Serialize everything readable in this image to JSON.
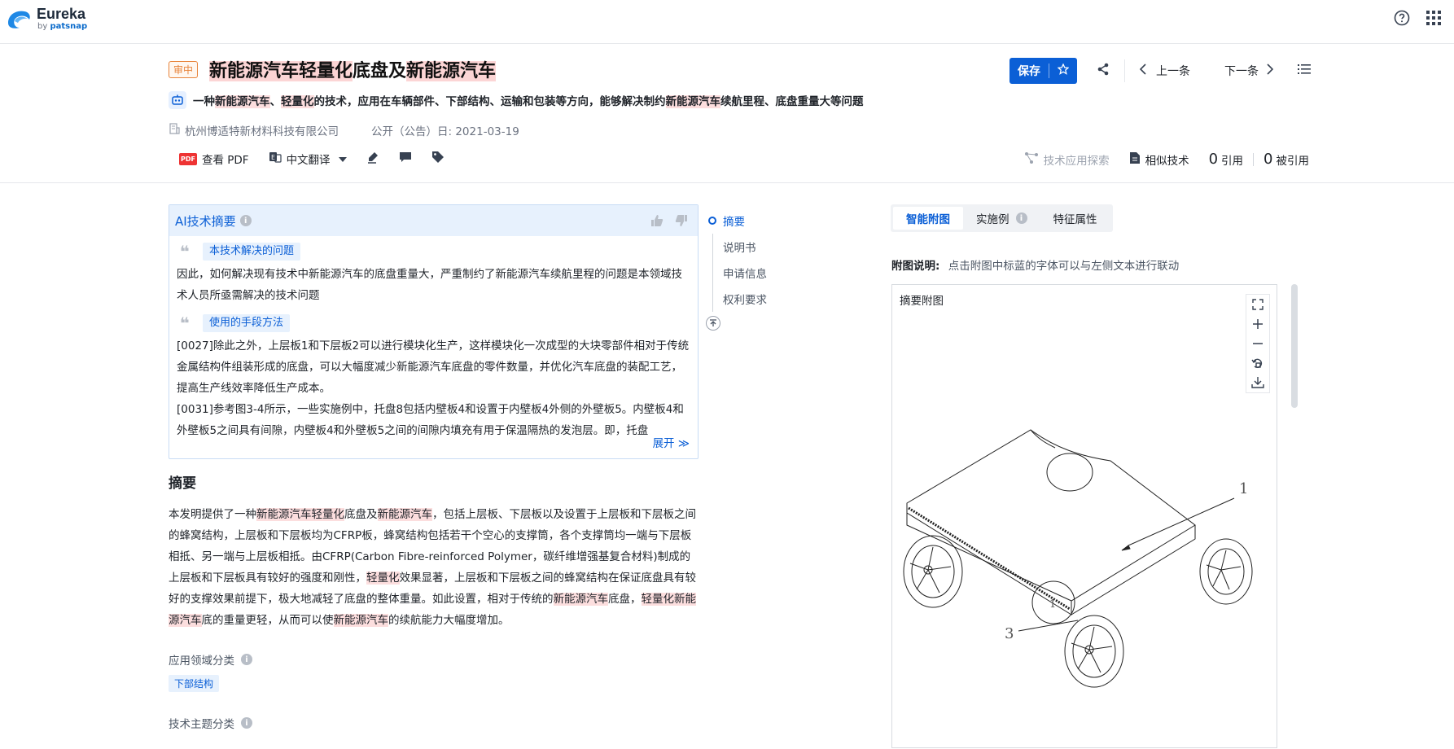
{
  "brand": {
    "name": "Eureka",
    "by": "by",
    "by_brand": "patsnap"
  },
  "header": {
    "status": "审中",
    "title_parts": [
      {
        "text": "新能源汽车轻量化",
        "hl": true
      },
      {
        "text": "底盘及",
        "hl": false
      },
      {
        "text": "新能源汽车",
        "hl": true
      }
    ],
    "ai_line_parts": [
      {
        "text": "一种",
        "hl": false
      },
      {
        "text": "新能源汽车",
        "hl": true
      },
      {
        "text": "、",
        "hl": false
      },
      {
        "text": "轻量化",
        "hl": true
      },
      {
        "text": "的技术，应用在车辆部件、下部结构、运输和包装等方向，能够解决制约",
        "hl": false
      },
      {
        "text": "新能源汽车",
        "hl": true
      },
      {
        "text": "续航里程、底盘重量大等问题",
        "hl": false
      }
    ],
    "company": "杭州博适特新材料科技有限公司",
    "pub_date": "公开（公告）日: 2021-03-19",
    "actions": {
      "save": "保存",
      "prev": "上一条",
      "next": "下一条"
    },
    "toolbar": {
      "pdf_badge": "PDF",
      "view_pdf": "查看 PDF",
      "translate": "中文翻译"
    },
    "right_tools": {
      "tech_explore": "技术应用探索",
      "similar": "相似技术",
      "cite_count": "0",
      "cite_label": "引用",
      "cited_count": "0",
      "cited_label": "被引用"
    }
  },
  "ai_summary": {
    "title": "AI技术摘要",
    "problem_label": "本技术解决的问题",
    "problem_text": "因此，如何解决现有技术中新能源汽车的底盘重量大，严重制约了新能源汽车续航里程的问题是本领域技术人员所亟需解决的技术问题",
    "means_label": "使用的手段方法",
    "means_text_1": "[0027]除此之外，上层板1和下层板2可以进行模块化生产，这样模块化一次成型的大块零部件相对于传统金属结构件组装形成的底盘，可以大幅度减少新能源汽车底盘的零件数量，并优化汽车底盘的装配工艺，提高生产线效率降低生产成本。",
    "means_text_2": "[0031]参考图3-4所示，一些实施例中，托盘8包括内壁板4和设置于内壁板4外侧的外壁板5。内壁板4和外壁板5之间具有间隙，内壁板4和外壁板5之间的间隙内填充有用于保温隔热的发泡层。即，托盘",
    "expand": "展开"
  },
  "abstract": {
    "title": "摘要",
    "parts": [
      {
        "text": "本发明提供了一种",
        "hl": false
      },
      {
        "text": "新能源汽车轻量化",
        "hl": true
      },
      {
        "text": "底盘及",
        "hl": false
      },
      {
        "text": "新能源汽车",
        "hl": true
      },
      {
        "text": "，包括上层板、下层板以及设置于上层板和下层板之间的蜂窝结构，上层板和下层板均为CFRP板，蜂窝结构包括若干个空心的支撑筒，各个支撑筒均一端与下层板相抵、另一端与上层板相抵。由CFRP(Carbon Fibre-reinforced Polymer，碳纤维增强基复合材料)制成的上层板和下层板具有较好的强度和刚性，",
        "hl": false
      },
      {
        "text": "轻量化",
        "hl": true
      },
      {
        "text": "效果显著，上层板和下层板之间的蜂窝结构在保证底盘具有较好的支撑效果前提下，极大地减轻了底盘的整体重量。如此设置，相对于传统的",
        "hl": false
      },
      {
        "text": "新能源汽车",
        "hl": true
      },
      {
        "text": "底盘，",
        "hl": false
      },
      {
        "text": "轻量化新能源汽车",
        "hl": true
      },
      {
        "text": "底的重量更轻，从而可以使",
        "hl": false
      },
      {
        "text": "新能源汽车",
        "hl": true
      },
      {
        "text": "的续航能力大幅度增加。",
        "hl": false
      }
    ],
    "app_field_label": "应用领域分类",
    "app_field_tag": "下部结构",
    "topic_label": "技术主题分类"
  },
  "outline": {
    "items": [
      "摘要",
      "说明书",
      "申请信息",
      "权利要求"
    ]
  },
  "figure_panel": {
    "tabs": [
      "智能附图",
      "实施例",
      "特征属性"
    ],
    "caption_label": "附图说明:",
    "caption_text": "点击附图中标蓝的字体可以与左侧文本进行联动",
    "figure_label": "摘要附图",
    "figure_numbers": [
      "1",
      "3",
      "1"
    ]
  },
  "colors": {
    "accent": "#0b5fd6",
    "highlight": "#fcd5d5",
    "status": "#e8833a"
  }
}
